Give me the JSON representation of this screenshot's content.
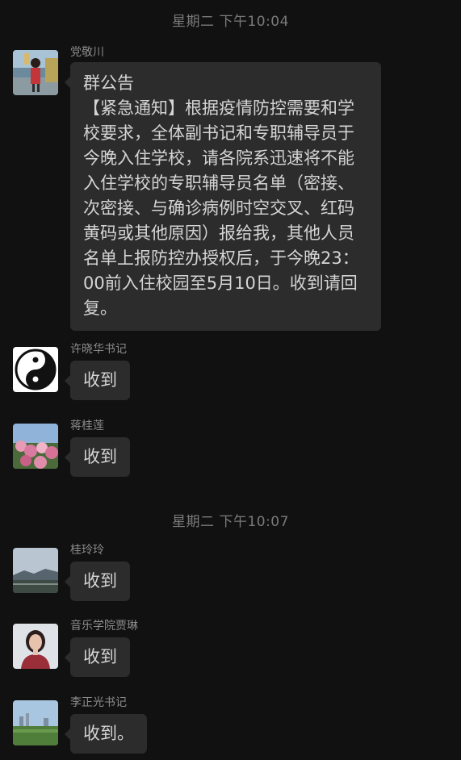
{
  "timestamps": [
    "星期二 下午10:04",
    "星期二 下午10:07"
  ],
  "messages": [
    {
      "sender": "党敬川",
      "avatar": "person-photo-avatar",
      "title": "群公告",
      "text": "【紧急通知】根据疫情防控需要和学校要求，全体副书记和专职辅导员于今晚入住学校，请各院系迅速将不能入住学校的专职辅导员名单（密接、次密接、与确诊病例时空交叉、红码黄码或其他原因）报给我，其他人员名单上报防控办授权后，于今晚23：00前入住校园至5月10日。收到请回复。"
    },
    {
      "sender": "许晓华书记",
      "avatar": "taiji-logo-avatar",
      "text": "收到"
    },
    {
      "sender": "蒋桂莲",
      "avatar": "flowers-photo-avatar",
      "text": "收到"
    },
    {
      "sender": "桂玲玲",
      "avatar": "landscape-photo-avatar",
      "text": "收到"
    },
    {
      "sender": "音乐学院贾琳",
      "avatar": "portrait-photo-avatar",
      "text": "收到"
    },
    {
      "sender": "李正光书记",
      "avatar": "city-photo-avatar",
      "text": "收到。"
    }
  ]
}
